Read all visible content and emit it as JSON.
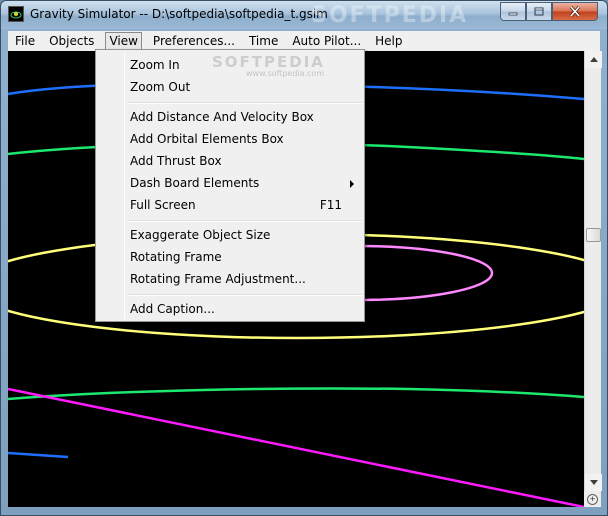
{
  "window": {
    "title": "Gravity Simulator -- D:\\softpedia\\softpedia_t.gsim",
    "watermark": "SOFTPEDIA",
    "buttons": {
      "minimize_icon": "minimize-icon",
      "maximize_icon": "maximize-icon",
      "close_icon": "close-icon"
    }
  },
  "menubar": {
    "items": [
      {
        "label": "File"
      },
      {
        "label": "Objects"
      },
      {
        "label": "View"
      },
      {
        "label": "Preferences..."
      },
      {
        "label": "Time"
      },
      {
        "label": "Auto Pilot..."
      },
      {
        "label": "Help"
      }
    ],
    "open_menu": "View"
  },
  "view_menu": {
    "watermark": "SOFTPEDIA",
    "watermark_url": "www.softpedia.com",
    "groups": [
      [
        {
          "label": "Zoom In"
        },
        {
          "label": "Zoom Out"
        }
      ],
      [
        {
          "label": "Add Distance And Velocity Box"
        },
        {
          "label": "Add Orbital Elements Box"
        },
        {
          "label": "Add Thrust Box"
        },
        {
          "label": "Dash Board Elements",
          "submenu": true
        },
        {
          "label": "Full Screen",
          "shortcut": "F11"
        }
      ],
      [
        {
          "label": "Exaggerate Object Size"
        },
        {
          "label": "Rotating Frame"
        },
        {
          "label": "Rotating Frame Adjustment..."
        }
      ],
      [
        {
          "label": "Add Caption..."
        }
      ]
    ]
  },
  "canvas": {
    "background": "#000000",
    "orbit_colors": {
      "blue": "#1f6fff",
      "green": "#1de86e",
      "yellow": "#ffff7a",
      "pink": "#ff88ff",
      "magenta": "#ff1aff"
    }
  },
  "scrollbar": {
    "up_icon": "scroll-up-arrow-icon",
    "down_icon": "scroll-down-arrow-icon"
  }
}
